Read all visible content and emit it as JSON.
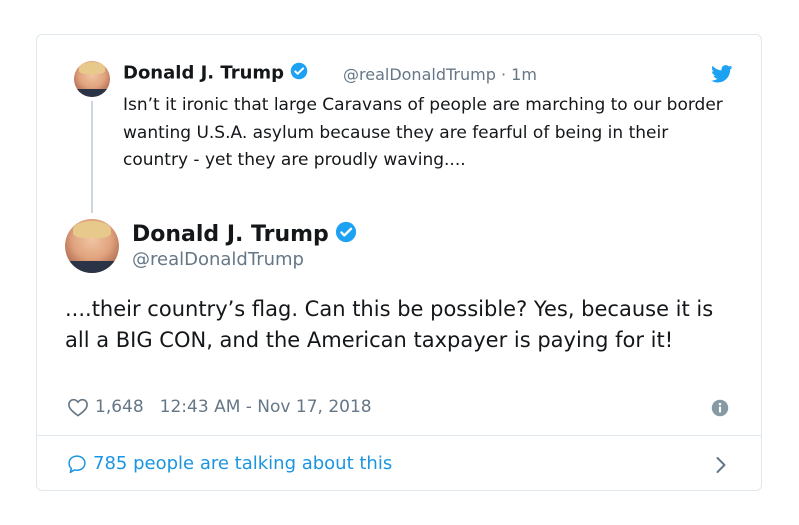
{
  "quoted_tweet": {
    "name": "Donald J. Trump",
    "handle": "@realDonaldTrump",
    "separator": "·",
    "time_ago": "1m",
    "text": "Isn’t it ironic that large Caravans of people are marching to our border wanting U.S.A. asylum because they are fearful of being in their country - yet they are proudly waving...."
  },
  "main_tweet": {
    "name": "Donald J. Trump",
    "handle": "@realDonaldTrump",
    "text": "....their country’s flag. Can this be possible? Yes, because it is all a BIG CON, and the American taxpayer is paying for it!",
    "likes": "1,648",
    "timestamp": "12:43 AM - Nov 17, 2018"
  },
  "footer": {
    "talking_label": "785 people are talking about this"
  },
  "colors": {
    "twitter_blue": "#1da1f2",
    "link_blue": "#1b95e0",
    "secondary_text": "#657786",
    "border": "#e1e8ed"
  },
  "icons": [
    "verified-badge-icon",
    "twitter-bird-icon",
    "heart-icon",
    "info-icon",
    "speech-bubble-icon",
    "chevron-right-icon"
  ]
}
